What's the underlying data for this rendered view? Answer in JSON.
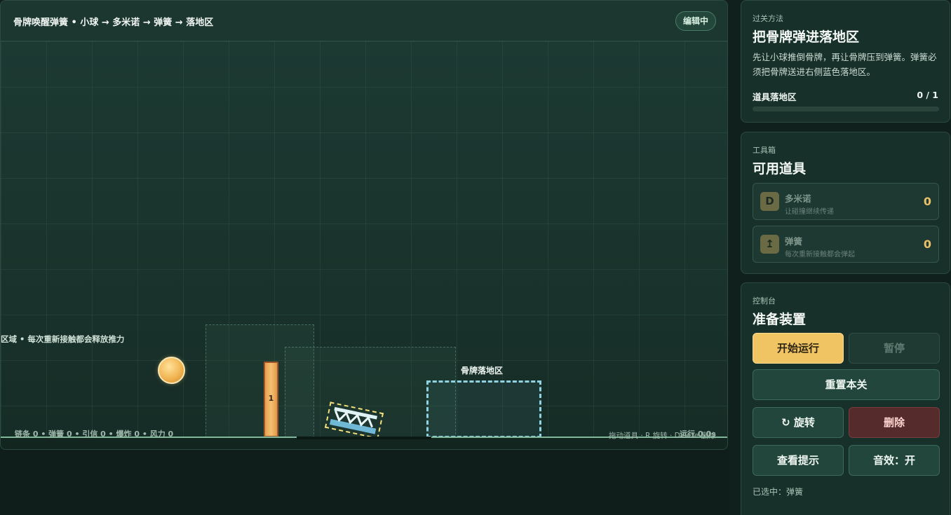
{
  "game": {
    "title": "骨牌唤醒弹簧 • 小球 → 多米诺 → 弹簧 → 落地区",
    "mode_badge": "编辑中",
    "zone_hint": "区域 • 每次重新接触都会释放推力",
    "domino_number": "1",
    "landing_zone_label": "骨牌落地区",
    "stats": "链条 0 • 弹簧 0 • 引信 0 • 爆炸 0 • 风力 0",
    "controls_hint": "拖动道具 · R 旋转 · Delete 删除",
    "run_time": "运行 0.0s",
    "colors": {
      "ball": "#f1b553",
      "domino": "#e9a14f",
      "landing_zone": "#8fd3e2",
      "spring_selection": "#f3e07a"
    }
  },
  "goal_panel": {
    "kicker": "过关方法",
    "title": "把骨牌弹进落地区",
    "description": "先让小球推倒骨牌，再让骨牌压到弹簧。弹簧必须把骨牌送进右侧蓝色落地区。",
    "progress_label": "道具落地区",
    "progress_count": "0 / 1",
    "progress_fraction": 0
  },
  "toolbox_panel": {
    "kicker": "工具箱",
    "title": "可用道具",
    "tools": [
      {
        "icon_letter": "D",
        "icon": "domino-icon",
        "name": "多米诺",
        "description": "让碰撞继续传递",
        "count": "0"
      },
      {
        "icon_letter": "↥",
        "icon": "spring-icon",
        "name": "弹簧",
        "description": "每次重新接触都会弹起",
        "count": "0"
      }
    ]
  },
  "control_panel": {
    "kicker": "控制台",
    "title": "准备装置",
    "buttons": {
      "start": "开始运行",
      "pause": "暂停",
      "reset": "重置本关",
      "rotate": "↻ 旋转",
      "delete": "删除",
      "hint": "查看提示",
      "sound": "音效：开"
    },
    "selected_note": "已选中：弹簧",
    "colors": {
      "start": "#f1c463",
      "delete": "#552b2b"
    }
  }
}
